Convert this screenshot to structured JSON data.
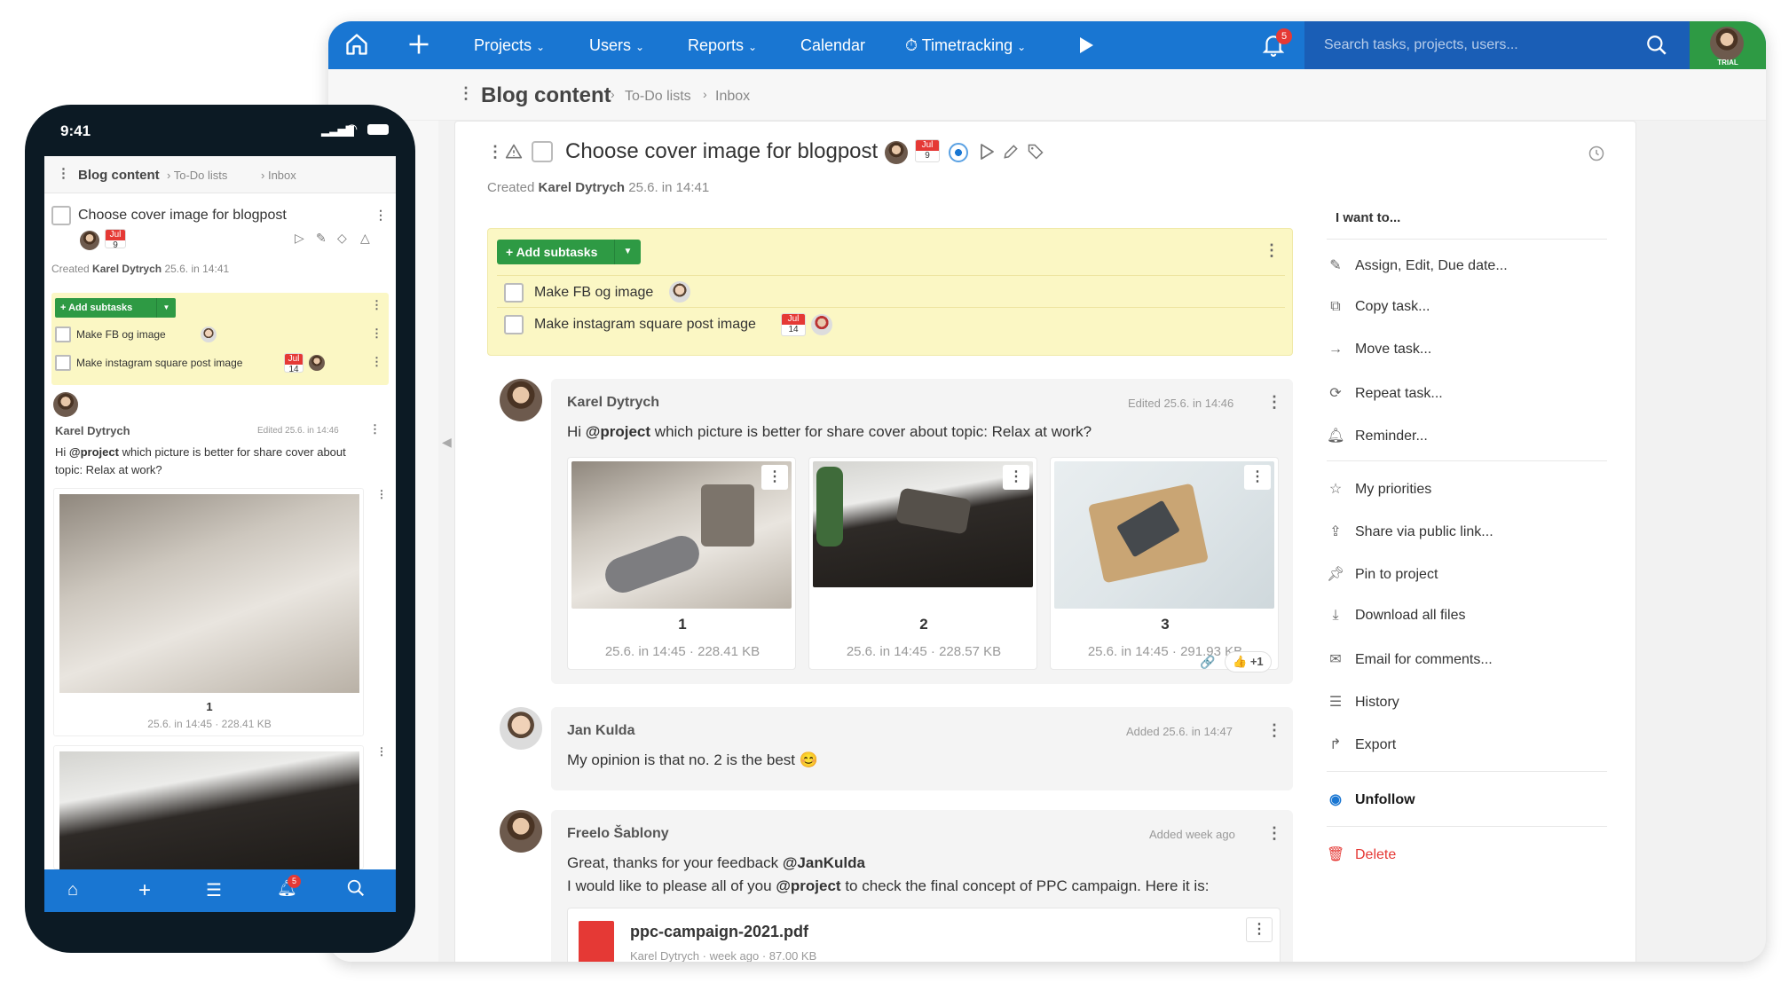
{
  "desktop": {
    "topbar": {
      "projects": "Projects",
      "users": "Users",
      "reports": "Reports",
      "calendar": "Calendar",
      "timetracking": "Timetracking",
      "notifications_count": "5",
      "search_placeholder": "Search tasks, projects, users...",
      "trial": "TRIAL"
    },
    "breadcrumb": {
      "project": "Blog content",
      "list": "To-Do lists",
      "folder": "Inbox"
    },
    "task": {
      "title": "Choose cover image for blogpost",
      "due_month": "Jul",
      "due_day": "9",
      "created_prefix": "Created",
      "created_by": "Karel Dytrych",
      "created_at": "25.6. in 14:41"
    },
    "subtasks": {
      "add_label": "Add subtasks",
      "items": [
        {
          "label": "Make FB og image"
        },
        {
          "label": "Make instagram square post image",
          "due_month": "Jul",
          "due_day": "14"
        }
      ]
    },
    "comments": [
      {
        "author": "Karel Dytrych",
        "meta": "Edited 25.6. in 14:46",
        "mention": "@project",
        "text_before": "Hi",
        "text_after": "which picture is better for share cover about topic: Relax at work?",
        "images": [
          {
            "name": "1",
            "date": "25.6. in 14:45",
            "size": "228.41 KB"
          },
          {
            "name": "2",
            "date": "25.6. in 14:45",
            "size": "228.57 KB"
          },
          {
            "name": "3",
            "date": "25.6. in 14:45",
            "size": "291.93 KB",
            "likes": "+1"
          }
        ]
      },
      {
        "author": "Jan Kulda",
        "meta": "Added 25.6. in 14:47",
        "text": "My opinion is that no. 2 is the best 😊"
      },
      {
        "author": "Freelo Šablony",
        "meta": "Added week ago",
        "line1_before": "Great, thanks for your feedback",
        "line1_mention": "@JanKulda",
        "line2_before": "I would like to please all of you",
        "line2_mention": "@project",
        "line2_after": "to check the final concept of PPC campaign. Here it is:",
        "file_name": "ppc-campaign-2021.pdf",
        "file_meta": "Karel Dytrych · week ago · 87.00 KB"
      }
    ],
    "menu": {
      "heading": "I want to...",
      "group1": [
        "Assign, Edit, Due date...",
        "Copy task...",
        "Move task...",
        "Repeat task...",
        "Reminder..."
      ],
      "group2": [
        "My priorities",
        "Share via public link...",
        "Pin to project",
        "Download all files",
        "Email for comments...",
        "History",
        "Export"
      ],
      "unfollow": "Unfollow",
      "delete": "Delete"
    }
  },
  "phone": {
    "time": "9:41",
    "breadcrumb": {
      "project": "Blog content",
      "list": "To-Do lists",
      "folder": "Inbox"
    },
    "task_title": "Choose cover image for blogpost",
    "due_month": "Jul",
    "due_day": "9",
    "created_prefix": "Created",
    "created_by": "Karel Dytrych",
    "created_at": "25.6. in 14:41",
    "add_subtasks": "Add subtasks",
    "subtasks": [
      {
        "label": "Make FB og image"
      },
      {
        "label": "Make instagram square post image",
        "due_month": "Jul",
        "due_day": "14"
      }
    ],
    "comment": {
      "author": "Karel Dytrych",
      "meta": "Edited 25.6. in 14:46",
      "text_before": "Hi",
      "mention": "@project",
      "text_after": "which picture is better for share cover about topic: Relax at work?",
      "image_name": "1",
      "image_date": "25.6. in 14:45",
      "image_size": "228.41 KB"
    },
    "notifications_count": "5"
  },
  "colors": {
    "brand_blue": "#1976d2",
    "green": "#2e9a44",
    "yellow_panel": "#fbf7c4",
    "danger": "#e53935"
  }
}
